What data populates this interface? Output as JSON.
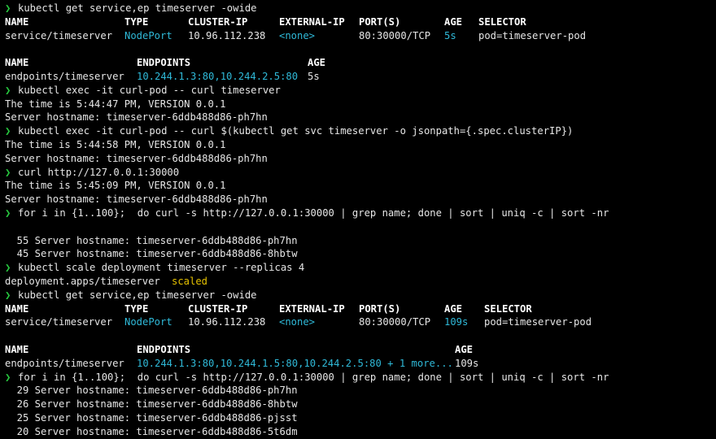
{
  "prompt_char": "❯",
  "colors": {
    "background": "#000000",
    "text": "#e6e6e6",
    "prompt": "#27c93f",
    "cyan": "#2fb9d8",
    "yellow": "#e5c100"
  },
  "lines": [
    {
      "type": "cmd",
      "text": "kubectl get service,ep timeserver -owide"
    },
    {
      "type": "header",
      "cols": [
        "NAME",
        "TYPE",
        "CLUSTER-IP",
        "EXTERNAL-IP",
        "PORT(S)",
        "AGE",
        "SELECTOR"
      ]
    },
    {
      "type": "svc",
      "cols": [
        "service/timeserver",
        "NodePort",
        "10.96.112.238",
        "<none>",
        "80:30000/TCP",
        "5s",
        "pod=timeserver-pod"
      ]
    },
    {
      "type": "blank"
    },
    {
      "type": "ephdr",
      "cols": [
        "NAME",
        "ENDPOINTS",
        "AGE"
      ]
    },
    {
      "type": "ep",
      "cols": [
        "endpoints/timeserver",
        "10.244.1.3:80,10.244.2.5:80",
        "5s"
      ]
    },
    {
      "type": "cmd",
      "text": "kubectl exec -it curl-pod -- curl timeserver"
    },
    {
      "type": "out",
      "text": "The time is 5:44:47 PM, VERSION 0.0.1"
    },
    {
      "type": "out",
      "text": "Server hostname: timeserver-6ddb488d86-ph7hn"
    },
    {
      "type": "cmd",
      "text": "kubectl exec -it curl-pod -- curl $(kubectl get svc timeserver -o jsonpath={.spec.clusterIP})"
    },
    {
      "type": "out",
      "text": "The time is 5:44:58 PM, VERSION 0.0.1"
    },
    {
      "type": "out",
      "text": "Server hostname: timeserver-6ddb488d86-ph7hn"
    },
    {
      "type": "cmd",
      "text": "curl http://127.0.0.1:30000"
    },
    {
      "type": "out",
      "text": "The time is 5:45:09 PM, VERSION 0.0.1"
    },
    {
      "type": "out",
      "text": "Server hostname: timeserver-6ddb488d86-ph7hn"
    },
    {
      "type": "cmd",
      "text": "for i in {1..100};  do curl -s http://127.0.0.1:30000 | grep name; done | sort | uniq -c | sort -nr"
    },
    {
      "type": "blank"
    },
    {
      "type": "out",
      "text": "  55 Server hostname: timeserver-6ddb488d86-ph7hn"
    },
    {
      "type": "out",
      "text": "  45 Server hostname: timeserver-6ddb488d86-8hbtw"
    },
    {
      "type": "cmd",
      "text": "kubectl scale deployment timeserver --replicas 4"
    },
    {
      "type": "scaled",
      "cols": [
        "deployment.apps/timeserver",
        "scaled"
      ]
    },
    {
      "type": "cmd",
      "text": "kubectl get service,ep timeserver -owide"
    },
    {
      "type": "header2",
      "cols": [
        "NAME",
        "TYPE",
        "CLUSTER-IP",
        "EXTERNAL-IP",
        "PORT(S)",
        "AGE",
        "SELECTOR"
      ]
    },
    {
      "type": "svc2",
      "cols": [
        "service/timeserver",
        "NodePort",
        "10.96.112.238",
        "<none>",
        "80:30000/TCP",
        "109s",
        "pod=timeserver-pod"
      ]
    },
    {
      "type": "blank"
    },
    {
      "type": "ephdr2",
      "cols": [
        "NAME",
        "ENDPOINTS",
        "AGE"
      ]
    },
    {
      "type": "ep2",
      "cols": [
        "endpoints/timeserver",
        "10.244.1.3:80,10.244.1.5:80,10.244.2.5:80 + 1 more...",
        "109s"
      ]
    },
    {
      "type": "cmd",
      "text": "for i in {1..100};  do curl -s http://127.0.0.1:30000 | grep name; done | sort | uniq -c | sort -nr"
    },
    {
      "type": "out",
      "text": "  29 Server hostname: timeserver-6ddb488d86-ph7hn"
    },
    {
      "type": "out",
      "text": "  26 Server hostname: timeserver-6ddb488d86-8hbtw"
    },
    {
      "type": "out",
      "text": "  25 Server hostname: timeserver-6ddb488d86-pjsst"
    },
    {
      "type": "out",
      "text": "  20 Server hostname: timeserver-6ddb488d86-5t6dm"
    }
  ]
}
